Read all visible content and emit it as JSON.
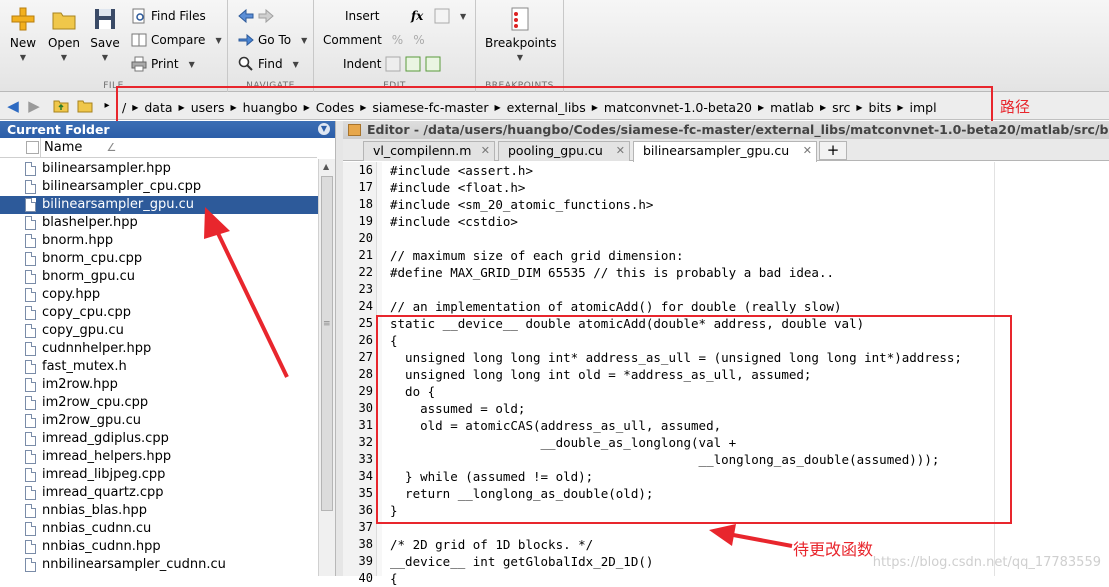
{
  "toolbar": {
    "new": "New",
    "open": "Open",
    "save": "Save",
    "find_files": "Find Files",
    "compare": "Compare",
    "print": "Print",
    "go_back_icon": "back-arrow-icon",
    "go_to": "Go To",
    "find": "Find",
    "insert": "Insert",
    "comment": "Comment",
    "indent": "Indent",
    "fx": "fx",
    "breakpoints": "Breakpoints",
    "groups": {
      "file": "FILE",
      "navigate": "NAVIGATE",
      "edit": "EDIT",
      "breakpoints": "BREAKPOINTS"
    }
  },
  "address": {
    "root": "/",
    "crumbs": [
      "data",
      "users",
      "huangbo",
      "Codes",
      "siamese-fc-master",
      "external_libs",
      "matconvnet-1.0-beta20",
      "matlab",
      "src",
      "bits",
      "impl"
    ],
    "annotation": "路径"
  },
  "current_folder": {
    "title": "Current Folder",
    "column": "Name",
    "sort_indicator": "∠",
    "files": [
      "bilinearsampler.hpp",
      "bilinearsampler_cpu.cpp",
      "bilinearsampler_gpu.cu",
      "blashelper.hpp",
      "bnorm.hpp",
      "bnorm_cpu.cpp",
      "bnorm_gpu.cu",
      "copy.hpp",
      "copy_cpu.cpp",
      "copy_gpu.cu",
      "cudnnhelper.hpp",
      "fast_mutex.h",
      "im2row.hpp",
      "im2row_cpu.cpp",
      "im2row_gpu.cu",
      "imread_gdiplus.cpp",
      "imread_helpers.hpp",
      "imread_libjpeg.cpp",
      "imread_quartz.cpp",
      "nnbias_blas.hpp",
      "nnbias_cudnn.cu",
      "nnbias_cudnn.hpp",
      "nnbilinearsampler_cudnn.cu"
    ],
    "selected_index": 2
  },
  "editor": {
    "title": "Editor - /data/users/huangbo/Codes/siamese-fc-master/external_libs/matconvnet-1.0-beta20/matlab/src/bi",
    "tabs": [
      "vl_compilenn.m",
      "pooling_gpu.cu",
      "bilinearsampler_gpu.cu"
    ],
    "active_tab": 2,
    "plus": "+",
    "lines": [
      {
        "n": "16",
        "t": "#include <assert.h>"
      },
      {
        "n": "17",
        "t": "#include <float.h>"
      },
      {
        "n": "18",
        "t": "#include <sm_20_atomic_functions.h>"
      },
      {
        "n": "19",
        "t": "#include <cstdio>"
      },
      {
        "n": "20",
        "t": ""
      },
      {
        "n": "21",
        "t": "// maximum size of each grid dimension:"
      },
      {
        "n": "22",
        "t": "#define MAX_GRID_DIM 65535 // this is probably a bad idea.."
      },
      {
        "n": "23",
        "t": ""
      },
      {
        "n": "24",
        "t": "// an implementation of atomicAdd() for double (really slow)"
      },
      {
        "n": "25",
        "t": "static __device__ double atomicAdd(double* address, double val)"
      },
      {
        "n": "26",
        "t": "{"
      },
      {
        "n": "27",
        "t": "  unsigned long long int* address_as_ull = (unsigned long long int*)address;"
      },
      {
        "n": "28",
        "t": "  unsigned long long int old = *address_as_ull, assumed;"
      },
      {
        "n": "29",
        "t": "  do {"
      },
      {
        "n": "30",
        "t": "    assumed = old;"
      },
      {
        "n": "31",
        "t": "    old = atomicCAS(address_as_ull, assumed,"
      },
      {
        "n": "32",
        "t": "                    __double_as_longlong(val +"
      },
      {
        "n": "33",
        "t": "                                         __longlong_as_double(assumed)));"
      },
      {
        "n": "34",
        "t": "  } while (assumed != old);"
      },
      {
        "n": "35",
        "t": "  return __longlong_as_double(old);"
      },
      {
        "n": "36",
        "t": "}"
      },
      {
        "n": "37",
        "t": ""
      },
      {
        "n": "38",
        "t": "/* 2D grid of 1D blocks. */"
      },
      {
        "n": "39",
        "t": "__device__ int getGlobalIdx_2D_1D()"
      },
      {
        "n": "40",
        "t": "{"
      }
    ],
    "annotation": "待更改函数"
  },
  "watermark": "https://blog.csdn.net/qq_17783559",
  "colors": {
    "annotation_red": "#e8262d",
    "selection": "#2d5a9a"
  }
}
